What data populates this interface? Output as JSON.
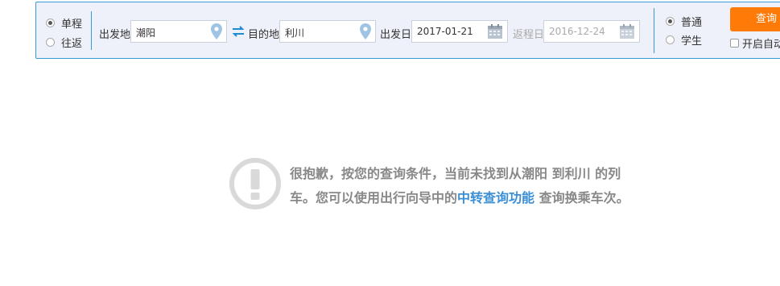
{
  "trip_type": {
    "one_way": "单程",
    "round_trip": "往返",
    "selected": "one_way"
  },
  "from": {
    "label": "出发地",
    "value": "潮阳"
  },
  "to": {
    "label": "目的地",
    "value": "利川"
  },
  "depart_date": {
    "label": "出发日",
    "value": "2017-01-21"
  },
  "return_date": {
    "label": "返程日",
    "value": "2016-12-24"
  },
  "passenger_type": {
    "normal": "普通",
    "student": "学生",
    "selected": "normal"
  },
  "query_button": "查询",
  "auto_query": "开启自动",
  "message": {
    "part1": "很抱歉，按您的查询条件，当前未找到从潮阳 到利川 的列车。您可以使用出行向导中的",
    "link": "中转查询功能",
    "part2": " 查询换乘车次。"
  },
  "colors": {
    "accent_blue": "#3b99d6",
    "button_orange": "#ff7a06",
    "link_blue": "#3b8fd6",
    "muted_gray": "#888888"
  }
}
